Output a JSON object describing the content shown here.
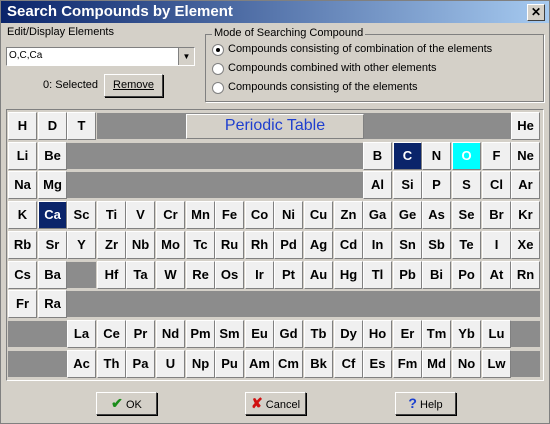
{
  "window": {
    "title": "Search Compounds by Element",
    "close_label": "✕"
  },
  "edit": {
    "label": "Edit/Display Elements",
    "value": "O,C,Ca",
    "selected_text": "0: Selected",
    "remove_label": "Remove"
  },
  "mode": {
    "legend": "Mode of Searching Compound",
    "options": [
      "Compounds consisting of combination of the elements",
      "Compounds combined with other elements",
      "Compounds consisting of the elements"
    ],
    "selected_index": 0
  },
  "table": {
    "title": "Periodic Table",
    "elements": [
      {
        "sym": "H",
        "col": 0,
        "row": 0
      },
      {
        "sym": "D",
        "col": 1,
        "row": 0
      },
      {
        "sym": "T",
        "col": 2,
        "row": 0
      },
      {
        "sym": "He",
        "col": 17,
        "row": 0
      },
      {
        "sym": "Li",
        "col": 0,
        "row": 1
      },
      {
        "sym": "Be",
        "col": 1,
        "row": 1
      },
      {
        "sym": "B",
        "col": 12,
        "row": 1
      },
      {
        "sym": "C",
        "col": 13,
        "row": 1,
        "state": "blue"
      },
      {
        "sym": "N",
        "col": 14,
        "row": 1
      },
      {
        "sym": "O",
        "col": 15,
        "row": 1,
        "state": "cyan"
      },
      {
        "sym": "F",
        "col": 16,
        "row": 1
      },
      {
        "sym": "Ne",
        "col": 17,
        "row": 1
      },
      {
        "sym": "Na",
        "col": 0,
        "row": 2
      },
      {
        "sym": "Mg",
        "col": 1,
        "row": 2
      },
      {
        "sym": "Al",
        "col": 12,
        "row": 2
      },
      {
        "sym": "Si",
        "col": 13,
        "row": 2
      },
      {
        "sym": "P",
        "col": 14,
        "row": 2
      },
      {
        "sym": "S",
        "col": 15,
        "row": 2
      },
      {
        "sym": "Cl",
        "col": 16,
        "row": 2
      },
      {
        "sym": "Ar",
        "col": 17,
        "row": 2
      },
      {
        "sym": "K",
        "col": 0,
        "row": 3
      },
      {
        "sym": "Ca",
        "col": 1,
        "row": 3,
        "state": "blue"
      },
      {
        "sym": "Sc",
        "col": 2,
        "row": 3
      },
      {
        "sym": "Ti",
        "col": 3,
        "row": 3
      },
      {
        "sym": "V",
        "col": 4,
        "row": 3
      },
      {
        "sym": "Cr",
        "col": 5,
        "row": 3
      },
      {
        "sym": "Mn",
        "col": 6,
        "row": 3
      },
      {
        "sym": "Fe",
        "col": 7,
        "row": 3
      },
      {
        "sym": "Co",
        "col": 8,
        "row": 3
      },
      {
        "sym": "Ni",
        "col": 9,
        "row": 3
      },
      {
        "sym": "Cu",
        "col": 10,
        "row": 3
      },
      {
        "sym": "Zn",
        "col": 11,
        "row": 3
      },
      {
        "sym": "Ga",
        "col": 12,
        "row": 3
      },
      {
        "sym": "Ge",
        "col": 13,
        "row": 3
      },
      {
        "sym": "As",
        "col": 14,
        "row": 3
      },
      {
        "sym": "Se",
        "col": 15,
        "row": 3
      },
      {
        "sym": "Br",
        "col": 16,
        "row": 3
      },
      {
        "sym": "Kr",
        "col": 17,
        "row": 3
      },
      {
        "sym": "Rb",
        "col": 0,
        "row": 4
      },
      {
        "sym": "Sr",
        "col": 1,
        "row": 4
      },
      {
        "sym": "Y",
        "col": 2,
        "row": 4
      },
      {
        "sym": "Zr",
        "col": 3,
        "row": 4
      },
      {
        "sym": "Nb",
        "col": 4,
        "row": 4
      },
      {
        "sym": "Mo",
        "col": 5,
        "row": 4
      },
      {
        "sym": "Tc",
        "col": 6,
        "row": 4
      },
      {
        "sym": "Ru",
        "col": 7,
        "row": 4
      },
      {
        "sym": "Rh",
        "col": 8,
        "row": 4
      },
      {
        "sym": "Pd",
        "col": 9,
        "row": 4
      },
      {
        "sym": "Ag",
        "col": 10,
        "row": 4
      },
      {
        "sym": "Cd",
        "col": 11,
        "row": 4
      },
      {
        "sym": "In",
        "col": 12,
        "row": 4
      },
      {
        "sym": "Sn",
        "col": 13,
        "row": 4
      },
      {
        "sym": "Sb",
        "col": 14,
        "row": 4
      },
      {
        "sym": "Te",
        "col": 15,
        "row": 4
      },
      {
        "sym": "I",
        "col": 16,
        "row": 4
      },
      {
        "sym": "Xe",
        "col": 17,
        "row": 4
      },
      {
        "sym": "Cs",
        "col": 0,
        "row": 5
      },
      {
        "sym": "Ba",
        "col": 1,
        "row": 5
      },
      {
        "sym": "Hf",
        "col": 3,
        "row": 5
      },
      {
        "sym": "Ta",
        "col": 4,
        "row": 5
      },
      {
        "sym": "W",
        "col": 5,
        "row": 5
      },
      {
        "sym": "Re",
        "col": 6,
        "row": 5
      },
      {
        "sym": "Os",
        "col": 7,
        "row": 5
      },
      {
        "sym": "Ir",
        "col": 8,
        "row": 5
      },
      {
        "sym": "Pt",
        "col": 9,
        "row": 5
      },
      {
        "sym": "Au",
        "col": 10,
        "row": 5
      },
      {
        "sym": "Hg",
        "col": 11,
        "row": 5
      },
      {
        "sym": "Tl",
        "col": 12,
        "row": 5
      },
      {
        "sym": "Pb",
        "col": 13,
        "row": 5
      },
      {
        "sym": "Bi",
        "col": 14,
        "row": 5
      },
      {
        "sym": "Po",
        "col": 15,
        "row": 5
      },
      {
        "sym": "At",
        "col": 16,
        "row": 5
      },
      {
        "sym": "Rn",
        "col": 17,
        "row": 5
      },
      {
        "sym": "Fr",
        "col": 0,
        "row": 6
      },
      {
        "sym": "Ra",
        "col": 1,
        "row": 6
      },
      {
        "sym": "La",
        "col": 2,
        "row": 7
      },
      {
        "sym": "Ce",
        "col": 3,
        "row": 7
      },
      {
        "sym": "Pr",
        "col": 4,
        "row": 7
      },
      {
        "sym": "Nd",
        "col": 5,
        "row": 7
      },
      {
        "sym": "Pm",
        "col": 6,
        "row": 7
      },
      {
        "sym": "Sm",
        "col": 7,
        "row": 7
      },
      {
        "sym": "Eu",
        "col": 8,
        "row": 7
      },
      {
        "sym": "Gd",
        "col": 9,
        "row": 7
      },
      {
        "sym": "Tb",
        "col": 10,
        "row": 7
      },
      {
        "sym": "Dy",
        "col": 11,
        "row": 7
      },
      {
        "sym": "Ho",
        "col": 12,
        "row": 7
      },
      {
        "sym": "Er",
        "col": 13,
        "row": 7
      },
      {
        "sym": "Tm",
        "col": 14,
        "row": 7
      },
      {
        "sym": "Yb",
        "col": 15,
        "row": 7
      },
      {
        "sym": "Lu",
        "col": 16,
        "row": 7
      },
      {
        "sym": "Ac",
        "col": 2,
        "row": 8
      },
      {
        "sym": "Th",
        "col": 3,
        "row": 8
      },
      {
        "sym": "Pa",
        "col": 4,
        "row": 8
      },
      {
        "sym": "U",
        "col": 5,
        "row": 8
      },
      {
        "sym": "Np",
        "col": 6,
        "row": 8
      },
      {
        "sym": "Pu",
        "col": 7,
        "row": 8
      },
      {
        "sym": "Am",
        "col": 8,
        "row": 8
      },
      {
        "sym": "Cm",
        "col": 9,
        "row": 8
      },
      {
        "sym": "Bk",
        "col": 10,
        "row": 8
      },
      {
        "sym": "Cf",
        "col": 11,
        "row": 8
      },
      {
        "sym": "Es",
        "col": 12,
        "row": 8
      },
      {
        "sym": "Fm",
        "col": 13,
        "row": 8
      },
      {
        "sym": "Md",
        "col": 14,
        "row": 8
      },
      {
        "sym": "No",
        "col": 15,
        "row": 8
      },
      {
        "sym": "Lw",
        "col": 16,
        "row": 8
      }
    ]
  },
  "buttons": {
    "ok_label": "OK",
    "cancel_label": "Cancel",
    "help_label": "Help",
    "ok_icon": "✔",
    "cancel_icon": "✘",
    "help_icon": "?"
  },
  "colors": {
    "selected_blue": "#0a246a",
    "selected_cyan": "#00ffff",
    "title_link": "#1f3fcf"
  }
}
